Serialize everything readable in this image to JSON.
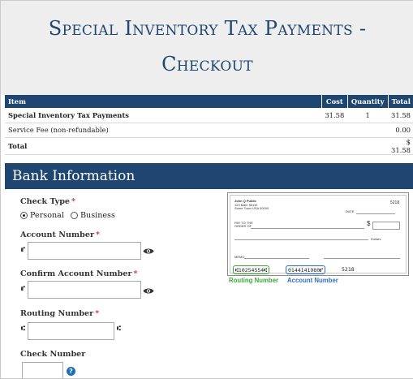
{
  "title": {
    "line1": "Special Inventory Tax Payments -",
    "line2": "Checkout"
  },
  "items_table": {
    "headers": [
      "Item",
      "Cost",
      "Quantity",
      "Total"
    ],
    "rows": [
      {
        "item": "Special Inventory Tax Payments",
        "cost": "31.58",
        "quantity": "1",
        "total": "31.58"
      },
      {
        "item": "Service Fee (non-refundable)",
        "cost": "",
        "quantity": "",
        "total": "0.00"
      },
      {
        "item": "Total",
        "cost": "",
        "quantity": "",
        "total": "$ 31.58"
      }
    ]
  },
  "bank": {
    "header": "Bank Information",
    "check_type": {
      "label": "Check Type",
      "required": "*",
      "options": [
        "Personal",
        "Business"
      ],
      "selected": "Personal"
    },
    "account_number": {
      "label": "Account Number",
      "required": "*",
      "value": ""
    },
    "confirm_account_number": {
      "label": "Confirm Account Number",
      "required": "*",
      "value": ""
    },
    "routing_number": {
      "label": "Routing Number",
      "required": "*",
      "value": ""
    },
    "check_number": {
      "label": "Check Number",
      "value": ""
    },
    "symbols": {
      "account": "⑈",
      "routing": "⑆"
    }
  },
  "check_image": {
    "payer_name": "John Q Public",
    "payer_address1": "123 Main Street",
    "payer_address2": "Some Town USA 00000",
    "check_no": "5218",
    "date_label": "DATE",
    "pay_to_label": "PAY TO THE",
    "order_of_label": "ORDER OF",
    "dollar_sign": "$",
    "dollars_label": "Dollars",
    "memo_label": "MEMO",
    "routing_digits": "⑆10254554⑆",
    "account_digits": "0144141980⑈",
    "check_digits": "5218",
    "routing_caption": "Routing Number",
    "account_caption": "Account Number"
  },
  "colors": {
    "navy": "#1f4670",
    "routing_green": "#3aaa35",
    "account_blue": "#2f6fc5",
    "required_red": "#c0392b"
  }
}
